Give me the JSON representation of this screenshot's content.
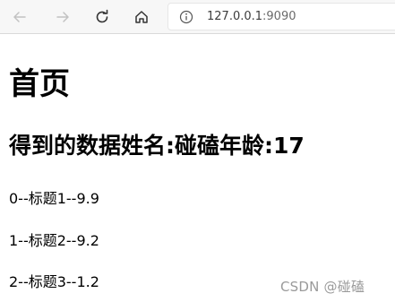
{
  "browser": {
    "url_host": "127.0.0.1",
    "url_port": ":9090",
    "icons": [
      "back-arrow-icon",
      "forward-arrow-icon",
      "reload-icon",
      "home-icon",
      "info-icon"
    ]
  },
  "page": {
    "heading": "首页",
    "subheading": "得到的数据姓名:碰磕年龄:17",
    "items": [
      "0--标题1--9.9",
      "1--标题2--9.2",
      "2--标题3--1.2"
    ]
  },
  "watermark": "CSDN @碰磕"
}
